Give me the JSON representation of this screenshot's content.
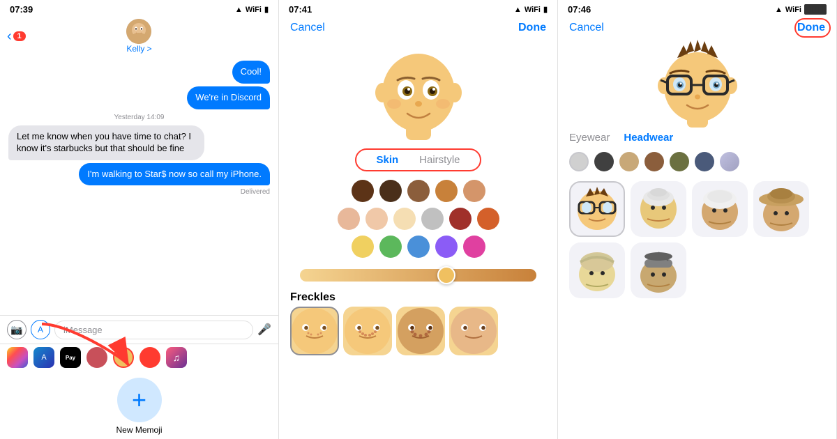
{
  "panel1": {
    "statusBar": {
      "time": "07:39",
      "signal": "▲",
      "wifi": "WiFi",
      "battery": "🔋"
    },
    "navBack": "1",
    "contactName": "Kelly >",
    "messages": [
      {
        "id": "m1",
        "type": "sent",
        "text": "Cool!"
      },
      {
        "id": "m2",
        "type": "sent",
        "text": "We're in Discord"
      },
      {
        "id": "m3",
        "type": "timestamp",
        "text": "Yesterday 14:09"
      },
      {
        "id": "m4",
        "type": "received",
        "text": "Let me know when you have time to chat? I know it's starbucks but that should be fine"
      },
      {
        "id": "m5",
        "type": "sent",
        "text": "I'm walking to Star$ now so call my iPhone."
      },
      {
        "id": "m6",
        "type": "delivered",
        "text": "Delivered"
      }
    ],
    "inputPlaceholder": "iMessage",
    "newMemojiLabel": "New Memoji"
  },
  "panel2": {
    "statusBar": {
      "time": "07:41"
    },
    "cancelLabel": "Cancel",
    "doneLabel": "Done",
    "tabs": [
      {
        "id": "skin",
        "label": "Skin",
        "active": true
      },
      {
        "id": "hairstyle",
        "label": "Hairstyle",
        "active": false
      }
    ],
    "skinColors": [
      [
        "#5c3317",
        "#4a2f1a",
        "#8B5E3C",
        "#c8813a",
        "#d4956a"
      ],
      [
        "#e8b89a",
        "#f0c8a8",
        "#f5deb3",
        "#c0c0c0",
        "#a0302a",
        "#d4602a"
      ],
      [
        "#f0d060",
        "#5cb85c",
        "#4a90d9",
        "#8b5cf6",
        "#e040a0"
      ]
    ],
    "frecklesLabel": "Freckles",
    "sliderValue": 62
  },
  "panel3": {
    "statusBar": {
      "time": "07:46"
    },
    "cancelLabel": "Cancel",
    "doneLabel": "Done",
    "tabs": [
      {
        "id": "eyewear",
        "label": "Eyewear",
        "active": false
      },
      {
        "id": "headwear",
        "label": "Headwear",
        "active": true
      }
    ],
    "eyewearColors": [
      "#D0D0D0",
      "#404040",
      "#C8A878",
      "#8B5E3C",
      "#6B7040",
      "#4A5A7A"
    ]
  }
}
